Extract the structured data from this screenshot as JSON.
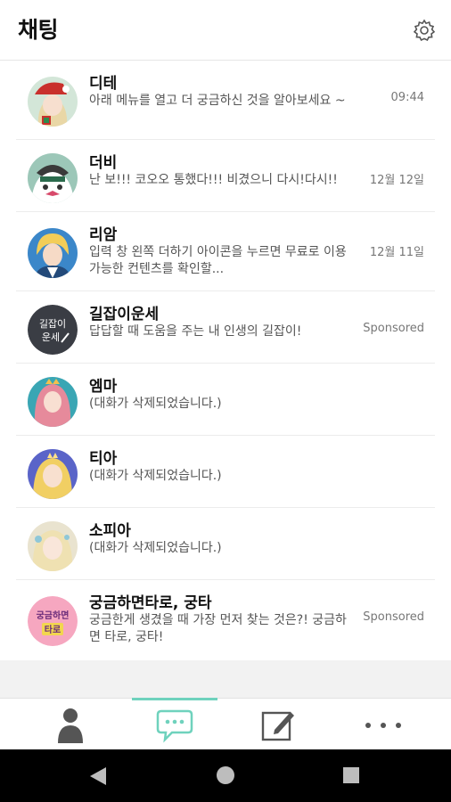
{
  "header": {
    "title": "채팅",
    "settings_icon": "gear-icon"
  },
  "chats": [
    {
      "name": "디테",
      "message": "아래 메뉴를 열고 더 궁금하신 것을 알아보세요 ~",
      "time": "09:44",
      "avatar": "avatar-ditte"
    },
    {
      "name": "더비",
      "message": "난 보!!! 코오오 통했다!!! 비겼으니 다시!다시!!",
      "time": "12월 12일",
      "avatar": "avatar-derby"
    },
    {
      "name": "리암",
      "message": "입력 창 왼쪽 더하기 아이콘을 누르면 무료로 이용 가능한 컨텐츠를 확인할...",
      "time": "12월 11일",
      "avatar": "avatar-liam"
    },
    {
      "name": "길잡이운세",
      "message": "답답할 때 도움을 주는 내 인생의 길잡이!",
      "time": "Sponsored",
      "avatar": "avatar-guide",
      "avatar_text": "길잡이\n운세"
    },
    {
      "name": "엠마",
      "message": "(대화가 삭제되었습니다.)",
      "time": "",
      "avatar": "avatar-emma"
    },
    {
      "name": "티아",
      "message": "(대화가 삭제되었습니다.)",
      "time": "",
      "avatar": "avatar-tia"
    },
    {
      "name": "소피아",
      "message": "(대화가 삭제되었습니다.)",
      "time": "",
      "avatar": "avatar-sofia"
    },
    {
      "name": "궁금하면타로, 궁타",
      "message": "궁금한게 생겼을 때 가장 먼저 찾는 것은?! 궁금하면 타로, 궁타!",
      "time": "Sponsored",
      "avatar": "avatar-tarot",
      "avatar_text": "궁금하면\n타로"
    }
  ],
  "tabs": [
    {
      "icon": "person-icon",
      "active": false
    },
    {
      "icon": "chat-bubble-icon",
      "active": true
    },
    {
      "icon": "edit-icon",
      "active": false
    },
    {
      "icon": "more-icon",
      "active": false
    }
  ],
  "system_nav": [
    "back-icon",
    "home-icon",
    "recents-icon"
  ],
  "colors": {
    "accent": "#6fd2bd",
    "tab_icon": "#555555"
  }
}
